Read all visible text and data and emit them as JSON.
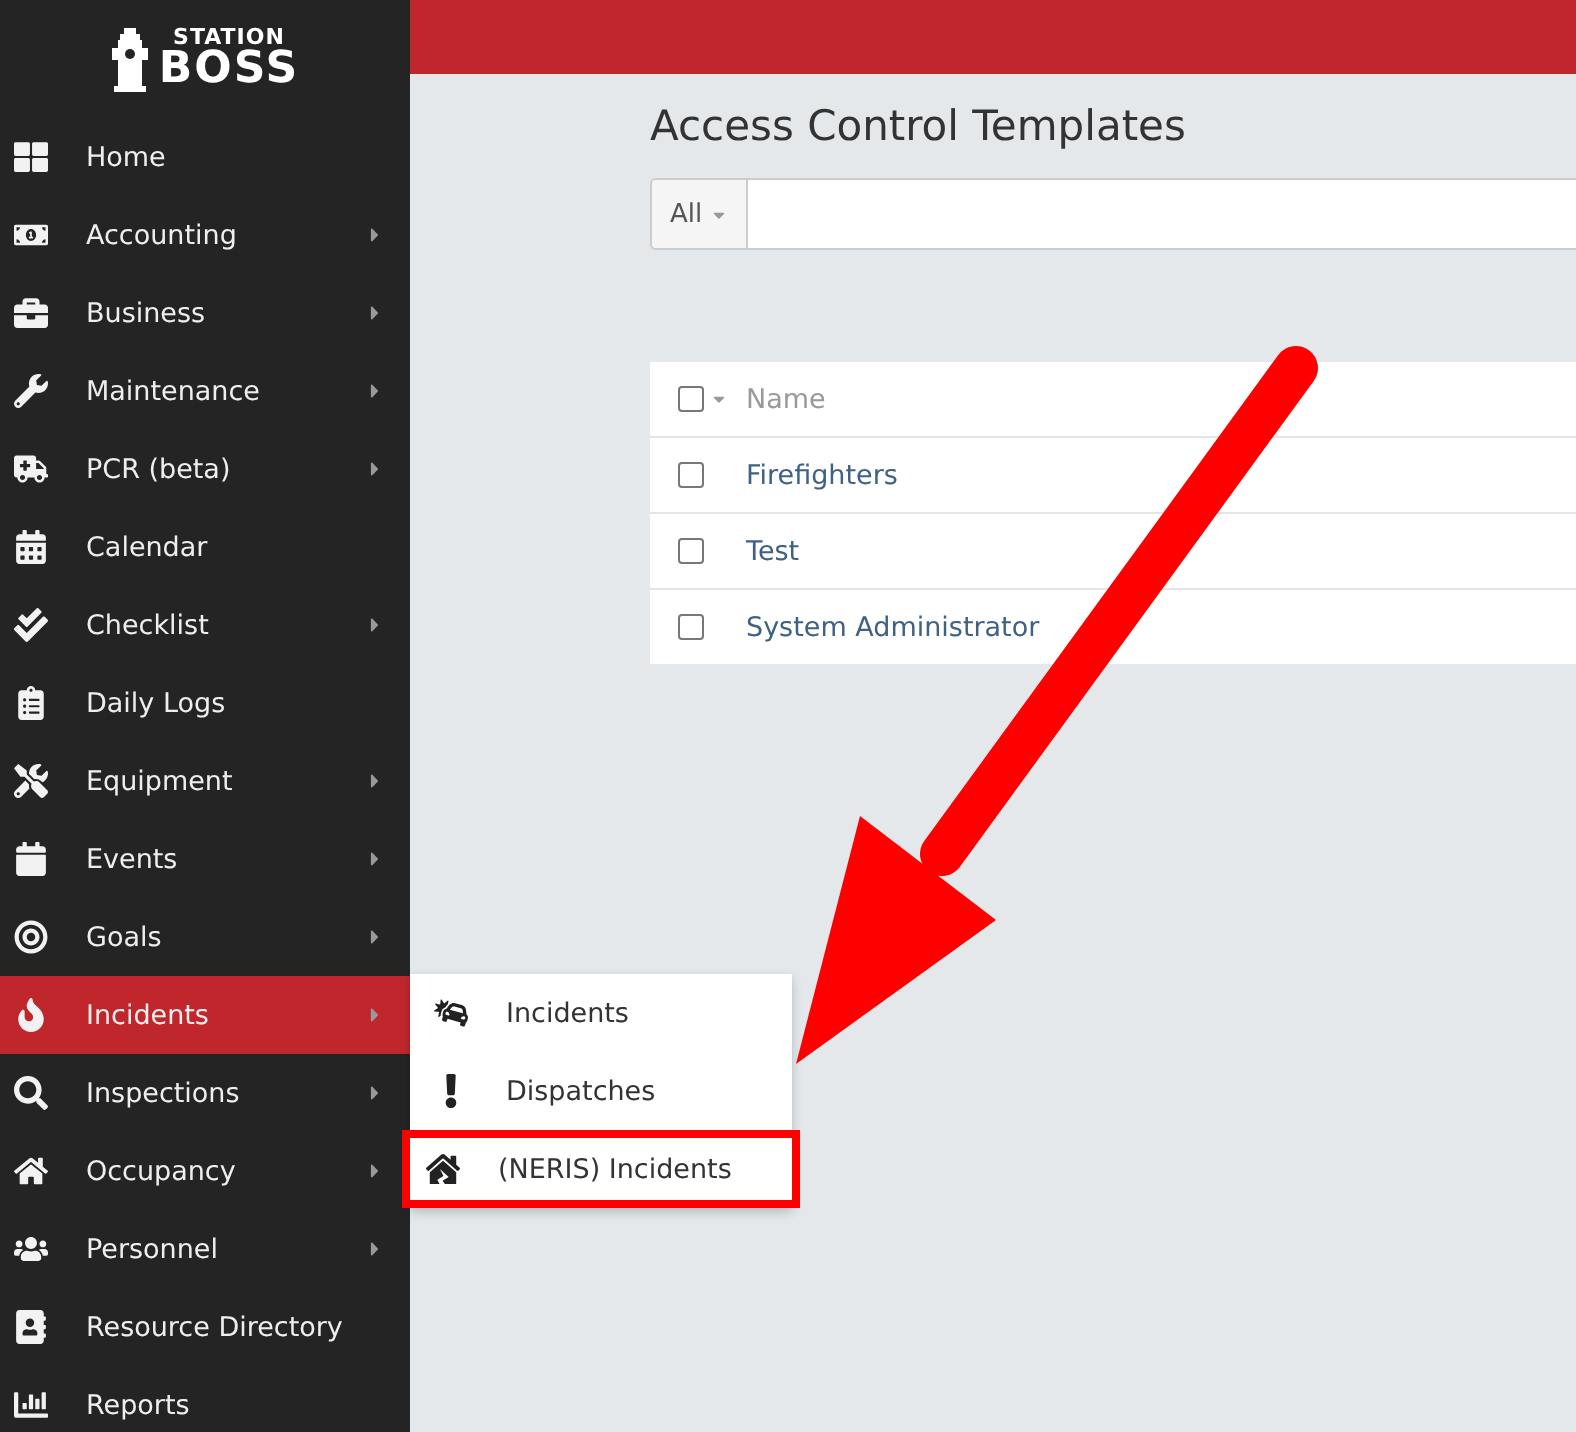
{
  "logo": {
    "line_1": "STATION",
    "line_2": "BOSS"
  },
  "sidebar": {
    "items": [
      {
        "label": "Home",
        "has_submenu": false,
        "selected": false
      },
      {
        "label": "Accounting",
        "has_submenu": true,
        "selected": false
      },
      {
        "label": "Business",
        "has_submenu": true,
        "selected": false
      },
      {
        "label": "Maintenance",
        "has_submenu": true,
        "selected": false
      },
      {
        "label": "PCR (beta)",
        "has_submenu": true,
        "selected": false
      },
      {
        "label": "Calendar",
        "has_submenu": false,
        "selected": false
      },
      {
        "label": "Checklist",
        "has_submenu": true,
        "selected": false
      },
      {
        "label": "Daily Logs",
        "has_submenu": false,
        "selected": false
      },
      {
        "label": "Equipment",
        "has_submenu": true,
        "selected": false
      },
      {
        "label": "Events",
        "has_submenu": true,
        "selected": false
      },
      {
        "label": "Goals",
        "has_submenu": true,
        "selected": false
      },
      {
        "label": "Incidents",
        "has_submenu": true,
        "selected": true
      },
      {
        "label": "Inspections",
        "has_submenu": true,
        "selected": false
      },
      {
        "label": "Occupancy",
        "has_submenu": true,
        "selected": false
      },
      {
        "label": "Personnel",
        "has_submenu": true,
        "selected": false
      },
      {
        "label": "Resource Directory",
        "has_submenu": false,
        "selected": false
      },
      {
        "label": "Reports",
        "has_submenu": false,
        "selected": false
      }
    ]
  },
  "submenu": {
    "items": [
      {
        "label": "Incidents",
        "highlighted": false
      },
      {
        "label": "Dispatches",
        "highlighted": false
      },
      {
        "label": "(NERIS) Incidents",
        "highlighted": true
      }
    ]
  },
  "page": {
    "title": "Access Control Templates",
    "filter": {
      "value": "All"
    }
  },
  "table": {
    "columns": [
      "Name"
    ],
    "header_checked": false,
    "rows": [
      {
        "name": "Firefighters",
        "checked": false
      },
      {
        "name": "Test",
        "checked": false
      },
      {
        "name": "System Administrator",
        "checked": false
      }
    ]
  }
}
